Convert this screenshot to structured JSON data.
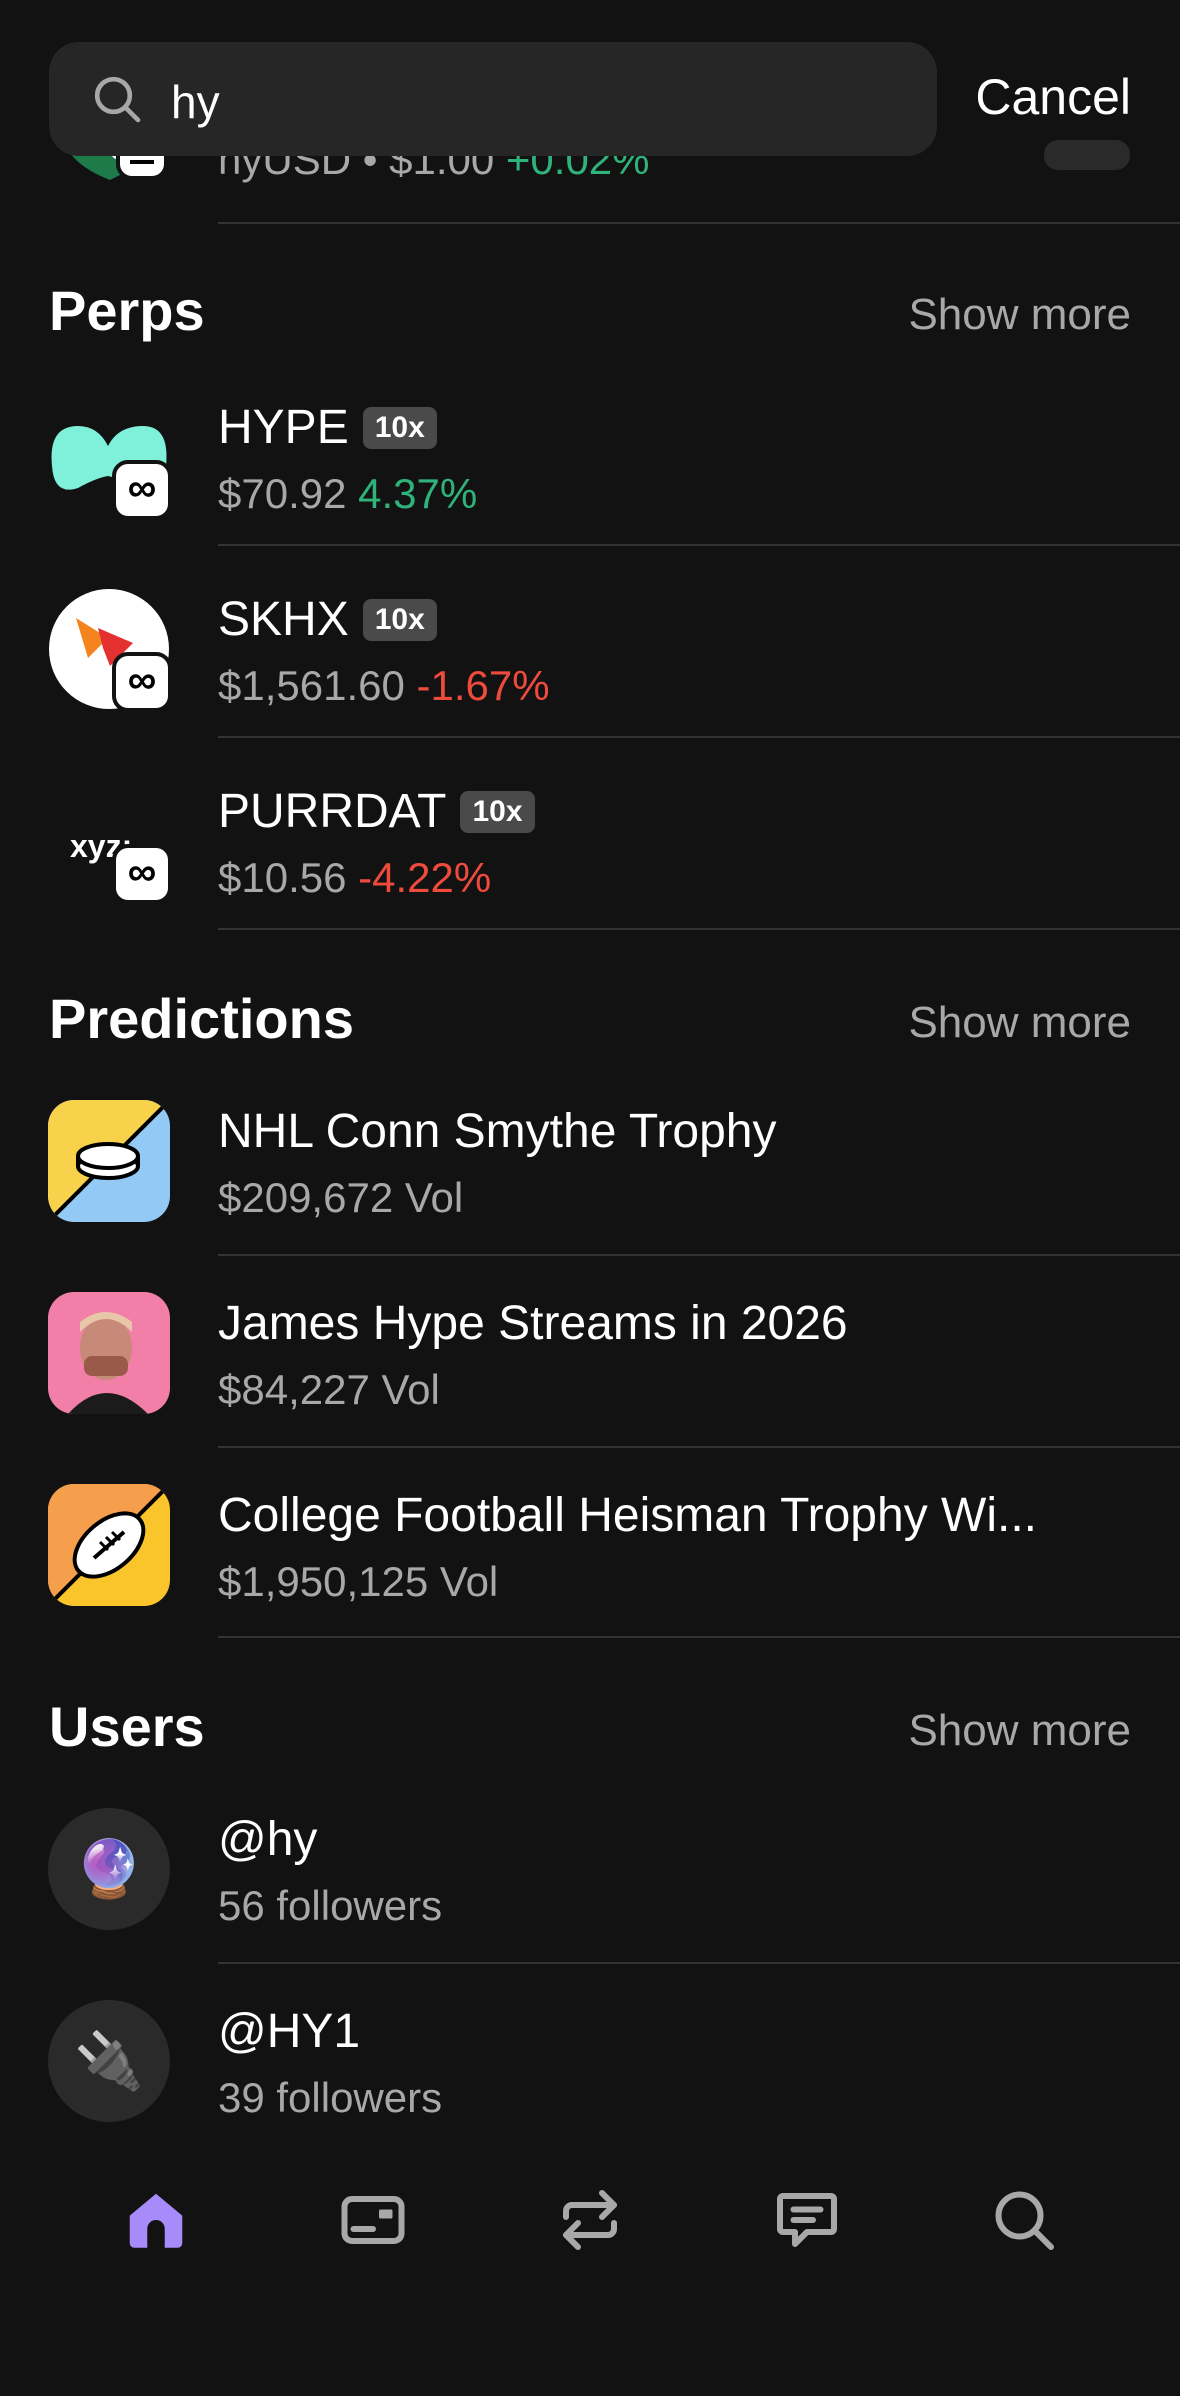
{
  "search": {
    "query": "hy",
    "cancel_label": "Cancel"
  },
  "partial_row": {
    "name": "hyUSD",
    "sep": "•",
    "price": "$1.00",
    "change": "+0.02%"
  },
  "perps": {
    "title": "Perps",
    "show_more": "Show more",
    "items": [
      {
        "symbol": "HYPE",
        "leverage": "10x",
        "price": "$70.92",
        "change": "4.37%",
        "direction": "up"
      },
      {
        "symbol": "SKHX",
        "leverage": "10x",
        "price": "$1,561.60",
        "change": "-1.67%",
        "direction": "down"
      },
      {
        "symbol": "PURRDAT",
        "leverage": "10x",
        "price": "$10.56",
        "change": "-4.22%",
        "direction": "down",
        "logo_text": "xyz:"
      }
    ]
  },
  "predictions": {
    "title": "Predictions",
    "show_more": "Show more",
    "items": [
      {
        "title": "NHL Conn Smythe Trophy",
        "volume": "$209,672 Vol"
      },
      {
        "title": "James Hype Streams in 2026",
        "volume": "$84,227 Vol"
      },
      {
        "title": "College Football Heisman Trophy Wi...",
        "volume": "$1,950,125 Vol"
      }
    ]
  },
  "users": {
    "title": "Users",
    "show_more": "Show more",
    "items": [
      {
        "handle": "@hy",
        "followers": "56 followers",
        "emoji": "🔮"
      },
      {
        "handle": "@HY1",
        "followers": "39 followers",
        "emoji": "🔌"
      }
    ]
  },
  "badge_symbol": "∞",
  "tabbar": {
    "active_color": "#a78bfa",
    "inactive_color": "#a8a8a8",
    "icons": [
      "home-icon",
      "wallet-icon",
      "swap-icon",
      "chat-icon",
      "search-icon"
    ]
  },
  "colors": {
    "positive": "#2fb37a",
    "negative": "#ef4b3c",
    "background": "#121212"
  }
}
